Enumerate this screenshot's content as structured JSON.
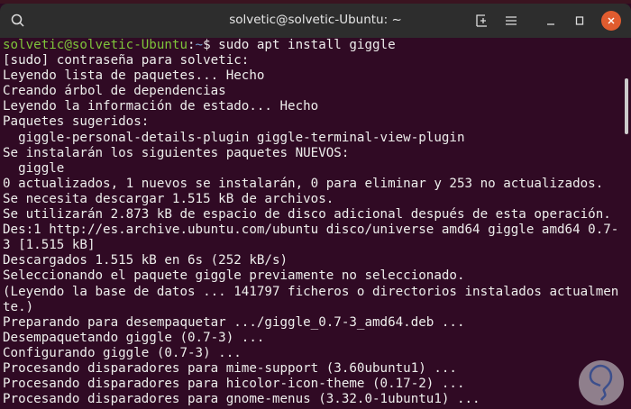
{
  "window": {
    "title": "solvetic@solvetic-Ubuntu: ~"
  },
  "icons": [
    "search-icon",
    "new-tab-icon",
    "menu-icon",
    "minimize-icon",
    "maximize-icon",
    "close-icon"
  ],
  "prompt": {
    "user_host": "solvetic@solvetic-Ubuntu",
    "path": "~",
    "symbol": "$",
    "command": " sudo apt install giggle"
  },
  "output": [
    "[sudo] contraseña para solvetic:",
    "Leyendo lista de paquetes... Hecho",
    "Creando árbol de dependencias",
    "Leyendo la información de estado... Hecho",
    "Paquetes sugeridos:",
    "  giggle-personal-details-plugin giggle-terminal-view-plugin",
    "Se instalarán los siguientes paquetes NUEVOS:",
    "  giggle",
    "0 actualizados, 1 nuevos se instalarán, 0 para eliminar y 253 no actualizados.",
    "Se necesita descargar 1.515 kB de archivos.",
    "Se utilizarán 2.873 kB de espacio de disco adicional después de esta operación.",
    "Des:1 http://es.archive.ubuntu.com/ubuntu disco/universe amd64 giggle amd64 0.7-",
    "3 [1.515 kB]",
    "Descargados 1.515 kB en 6s (252 kB/s)",
    "Seleccionando el paquete giggle previamente no seleccionado.",
    "(Leyendo la base de datos ... 141797 ficheros o directorios instalados actualmen",
    "te.)",
    "Preparando para desempaquetar .../giggle_0.7-3_amd64.deb ...",
    "Desempaquetando giggle (0.7-3) ...",
    "Configurando giggle (0.7-3) ...",
    "Procesando disparadores para mime-support (3.60ubuntu1) ...",
    "Procesando disparadores para hicolor-icon-theme (0.17-2) ...",
    "Procesando disparadores para gnome-menus (3.32.0-1ubuntu1) ..."
  ]
}
